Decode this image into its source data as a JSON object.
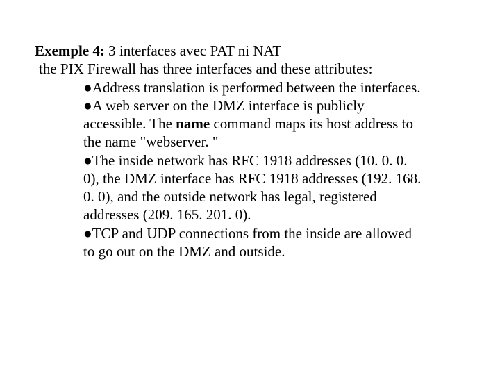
{
  "title_label": "Exemple 4:",
  "title_rest": " 3 interfaces avec PAT ni NAT",
  "intro": " the PIX Firewall has three interfaces and these attributes:",
  "bullets": {
    "b1": "Address translation is performed between the interfaces.",
    "b2a": "A web server on the DMZ interface is publicly accessible. The ",
    "b2name": "name",
    "b2b": " command maps its host address to the name \"webserver. \"",
    "b3": "The inside network has RFC 1918 addresses (10. 0. 0. 0), the DMZ interface has RFC 1918 addresses (192. 168. 0. 0), and the outside network has legal, registered addresses (209. 165. 201. 0).",
    "b4": "TCP and UDP connections from the inside are allowed to go out on the DMZ and outside."
  }
}
